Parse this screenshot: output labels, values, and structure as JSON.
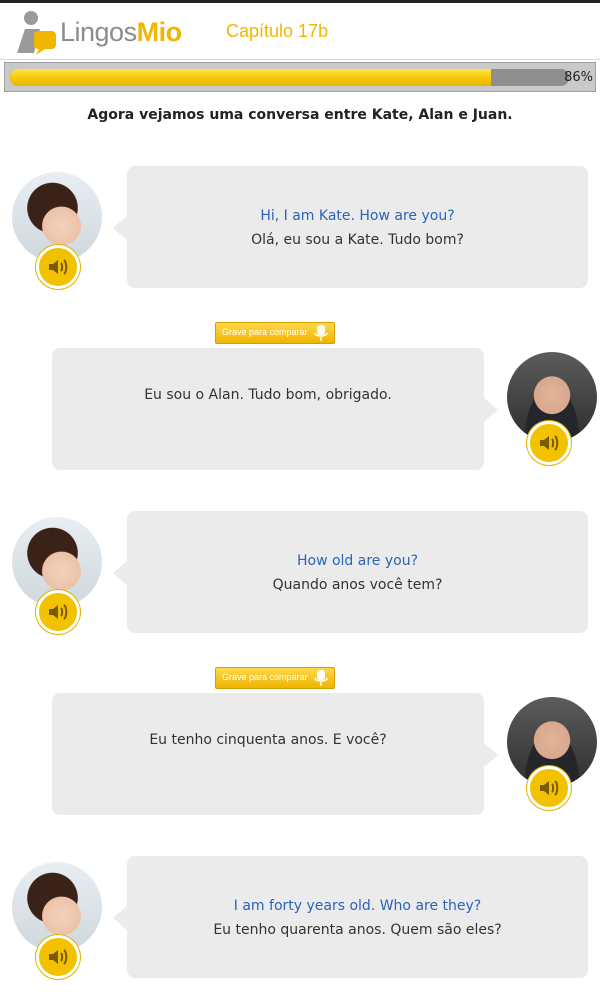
{
  "header": {
    "logo_lingos": "Lingos",
    "logo_mio": "Mio",
    "chapter": "Capítulo  17b"
  },
  "progress": {
    "value": 0.86,
    "label": "86%"
  },
  "intro": "Agora vejamos uma conversa entre Kate, Alan e Juan.",
  "record_button_label": "Grave para comparar",
  "dialogue": [
    {
      "speaker": "Kate",
      "en": "Hi, I am Kate. How are you?",
      "pt": "Olá, eu sou a Kate. Tudo bom?"
    },
    {
      "speaker": "Alan",
      "pt": "Eu sou o Alan. Tudo bom, obrigado."
    },
    {
      "speaker": "Kate",
      "en": "How old are you?",
      "pt": "Quando anos você tem?"
    },
    {
      "speaker": "Alan",
      "pt": "Eu tenho cinquenta anos. E você?"
    },
    {
      "speaker": "Kate",
      "en": "I am forty years old. Who are they?",
      "pt": "Eu tenho quarenta anos. Quem são eles?"
    }
  ],
  "colors": {
    "accent": "#f2b600",
    "english_text": "#2a63b8",
    "bubble": "#ebebeb"
  }
}
